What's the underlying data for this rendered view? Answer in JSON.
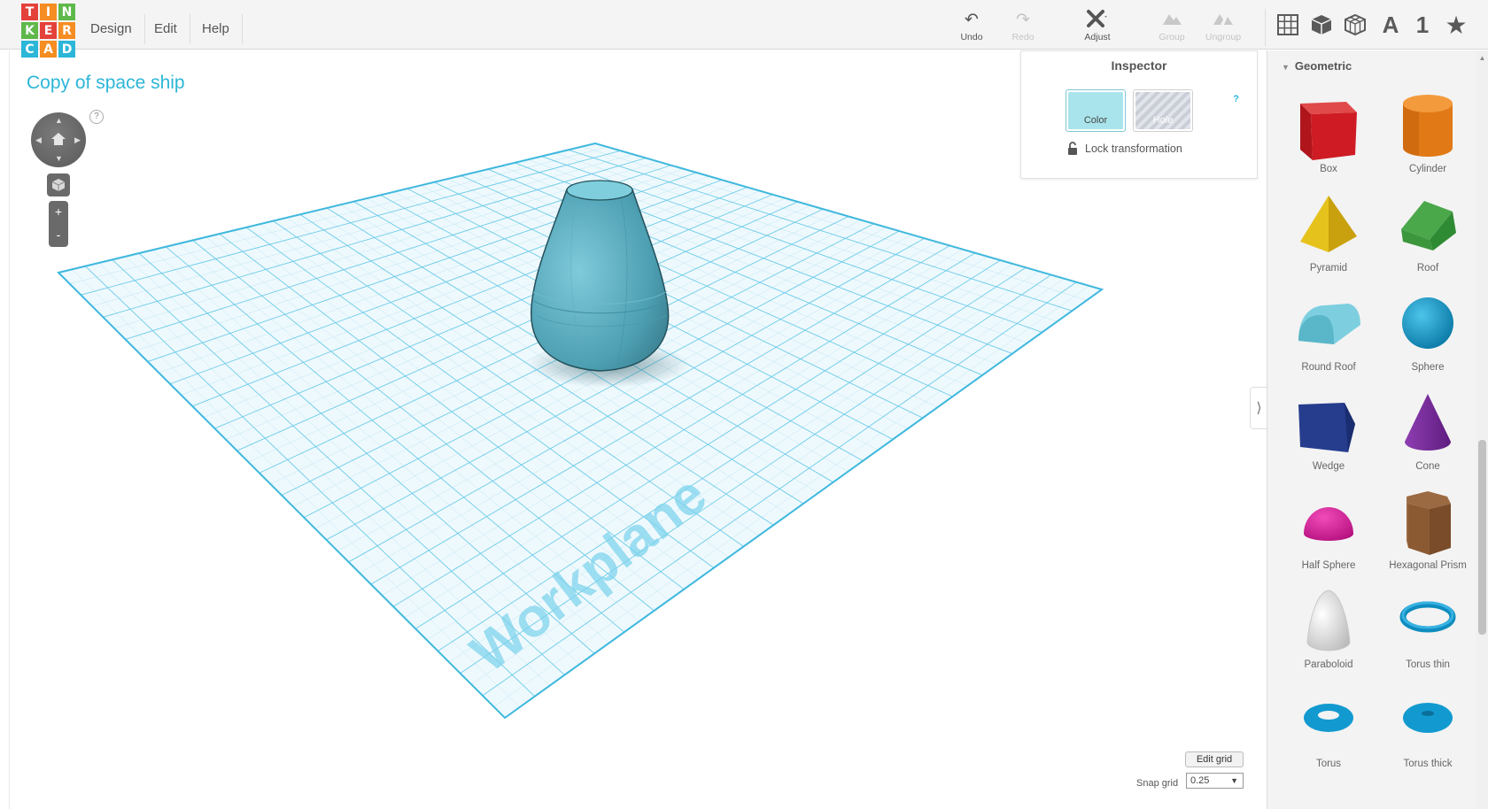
{
  "logo": {
    "letters": [
      "T",
      "I",
      "N",
      "K",
      "E",
      "R",
      "C",
      "A",
      "D"
    ],
    "colors": [
      "#e4413b",
      "#f58d22",
      "#5fb84a",
      "#5fb84a",
      "#e4413b",
      "#f58d22",
      "#2cb6d8",
      "#f58d22",
      "#2cb6d8"
    ]
  },
  "menu": {
    "design": "Design",
    "edit": "Edit",
    "help": "Help"
  },
  "toolbar": {
    "undo": "Undo",
    "redo": "Redo",
    "adjust": "Adjust",
    "group": "Group",
    "ungroup": "Ungroup"
  },
  "view_tools": {
    "letter": "A",
    "number": "1"
  },
  "design_title": "Copy of space ship",
  "nav": {
    "help": "?",
    "zoom_in": "+",
    "zoom_out": "-"
  },
  "workplane_label": "Workplane",
  "inspector": {
    "title": "Inspector",
    "help": "?",
    "color_label": "Color",
    "hole_label": "Hole",
    "lock_label": "Lock transformation",
    "selected_color": "#a9e4ec"
  },
  "panel": {
    "category": "Geometric",
    "shapes": [
      {
        "label": "Box"
      },
      {
        "label": "Cylinder"
      },
      {
        "label": "Pyramid"
      },
      {
        "label": "Roof"
      },
      {
        "label": "Round Roof"
      },
      {
        "label": "Sphere"
      },
      {
        "label": "Wedge"
      },
      {
        "label": "Cone"
      },
      {
        "label": "Half Sphere"
      },
      {
        "label": "Hexagonal Prism"
      },
      {
        "label": "Paraboloid"
      },
      {
        "label": "Torus thin"
      },
      {
        "label": "Torus"
      },
      {
        "label": "Torus thick"
      }
    ]
  },
  "grid": {
    "edit_label": "Edit grid",
    "snap_label": "Snap grid",
    "snap_value": "0.25"
  },
  "colors": {
    "accent": "#2cb6d8",
    "object": "#5ab0c2",
    "grid_line": "#4cc0e0"
  }
}
